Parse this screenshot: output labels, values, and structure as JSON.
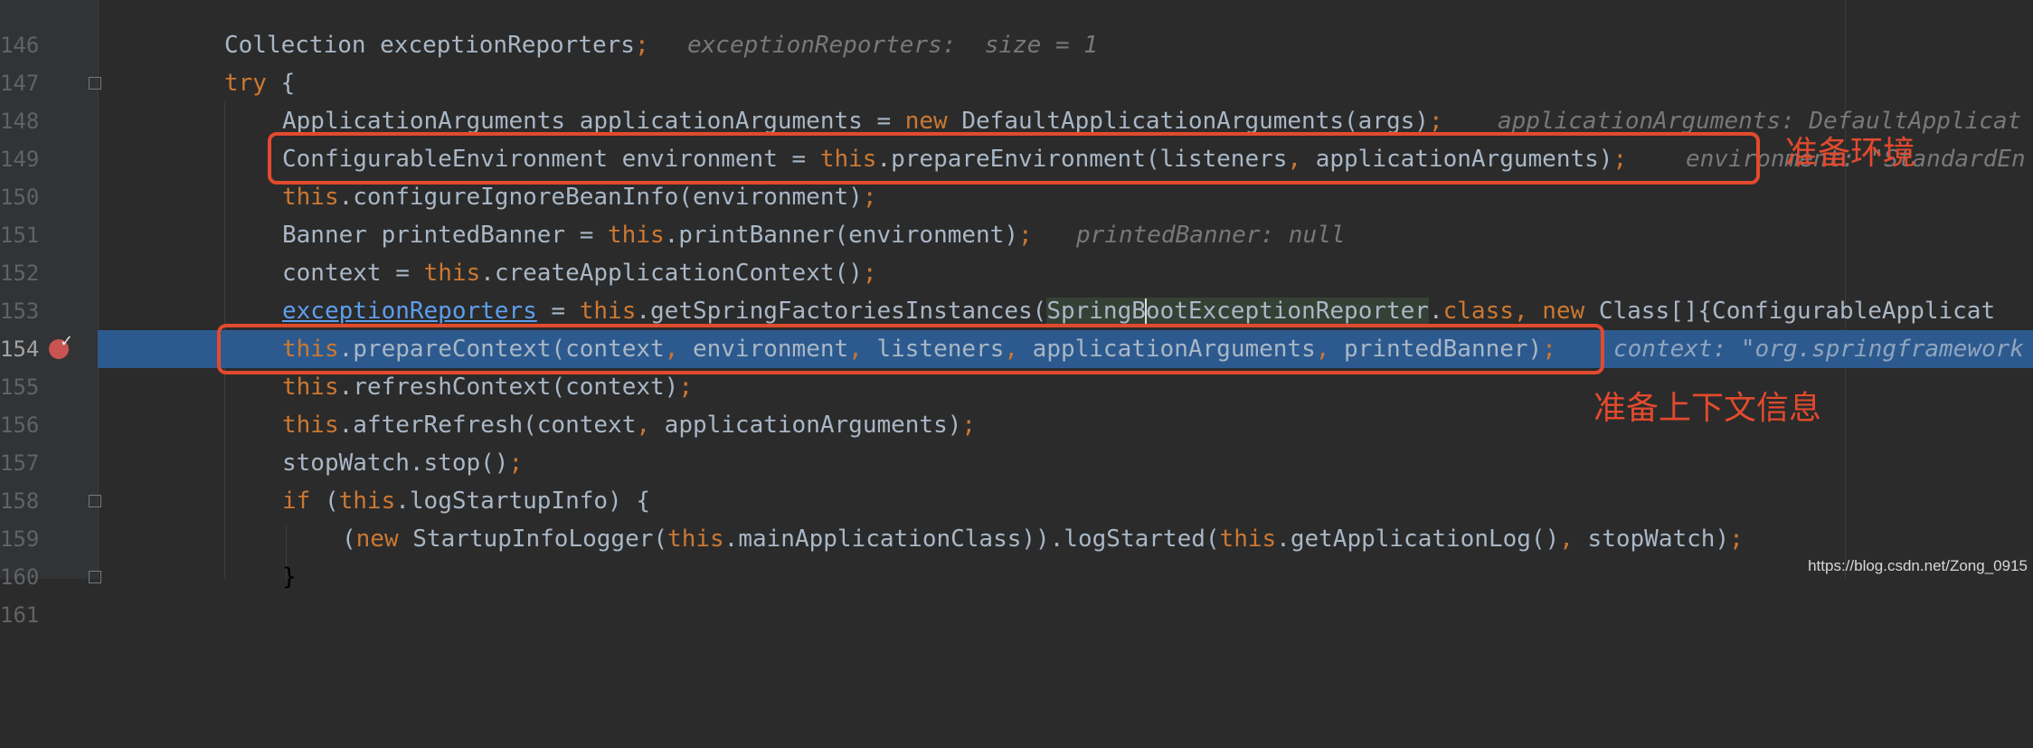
{
  "editor": {
    "lines": [
      {
        "num": "146",
        "code": ""
      },
      {
        "num": "147",
        "code": "Collection exceptionReporters;",
        "hint": "exceptionReporters:  size = 1"
      },
      {
        "num": "148",
        "code": "try {"
      },
      {
        "num": "149",
        "code": "ApplicationArguments applicationArguments = new DefaultApplicationArguments(args);",
        "hint": "applicationArguments: DefaultApplicat"
      },
      {
        "num": "150",
        "code": "ConfigurableEnvironment environment = this.prepareEnvironment(listeners, applicationArguments);",
        "hint": "environment: \"StandardEn"
      },
      {
        "num": "151",
        "code": "this.configureIgnoreBeanInfo(environment);"
      },
      {
        "num": "152",
        "code": "Banner printedBanner = this.printBanner(environment);",
        "hint": "printedBanner: null"
      },
      {
        "num": "153",
        "code": "context = this.createApplicationContext();"
      },
      {
        "num": "154",
        "code": "exceptionReporters = this.getSpringFactoriesInstances(SpringBootExceptionReporter.class, new Class[]{ConfigurableApplicat"
      },
      {
        "num": "155",
        "code": "this.prepareContext(context, environment, listeners, applicationArguments, printedBanner);",
        "hint": "context: \"org.springframework"
      },
      {
        "num": "156",
        "code": "this.refreshContext(context);"
      },
      {
        "num": "157",
        "code": "this.afterRefresh(context, applicationArguments);"
      },
      {
        "num": "158",
        "code": "stopWatch.stop();"
      },
      {
        "num": "159",
        "code": "if (this.logStartupInfo) {"
      },
      {
        "num": "160",
        "code": "(new StartupInfoLogger(this.mainApplicationClass)).logStarted(this.getApplicationLog(), stopWatch);"
      },
      {
        "num": "161",
        "code": "}"
      }
    ],
    "fold_icon": "fold-marker-icon",
    "breakpoint_icon": "breakpoint-check-icon"
  },
  "annotations": {
    "prepare_env": "准备环境",
    "prepare_context": "准备上下文信息",
    "accent_color": "#e24a2e"
  },
  "watermark": "https://blog.csdn.net/Zong_0915"
}
